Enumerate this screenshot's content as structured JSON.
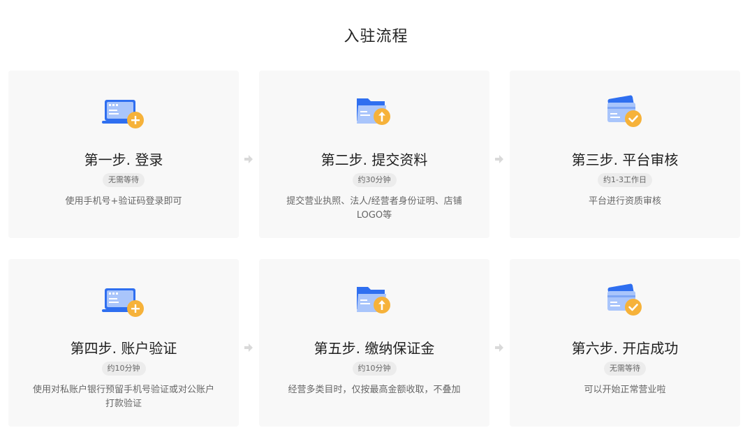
{
  "page": {
    "title": "入驻流程"
  },
  "steps": [
    {
      "icon": "laptop-add-icon",
      "title": "第一步. 登录",
      "badge": "无需等待",
      "desc": "使用手机号+验证码登录即可"
    },
    {
      "icon": "folder-upload-icon",
      "title": "第二步. 提交资料",
      "badge": "约30分钟",
      "desc": "提交营业执照、法人/经营者身份证明、店铺LOGO等"
    },
    {
      "icon": "card-check-icon",
      "title": "第三步. 平台审核",
      "badge": "约1-3工作日",
      "desc": "平台进行资质审核"
    },
    {
      "icon": "laptop-add-icon",
      "title": "第四步. 账户验证",
      "badge": "约10分钟",
      "desc": "使用对私账户银行预留手机号验证或对公账户打款验证"
    },
    {
      "icon": "folder-upload-icon",
      "title": "第五步. 缴纳保证金",
      "badge": "约10分钟",
      "desc": "经营多类目时，仅按最高金额收取，不叠加"
    },
    {
      "icon": "card-check-icon",
      "title": "第六步. 开店成功",
      "badge": "无需等待",
      "desc": "可以开始正常营业啦"
    }
  ],
  "colors": {
    "primary_blue": "#2f6ff0",
    "light_blue": "#a9c5fb",
    "accent_orange": "#f6b23a",
    "card_bg": "#f8f8f8",
    "arrow_gray": "#d9d9d9"
  }
}
